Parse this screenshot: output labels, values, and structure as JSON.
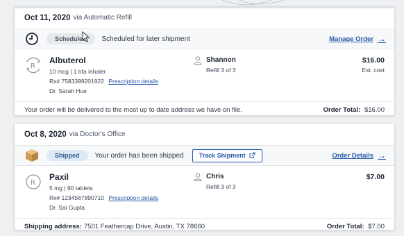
{
  "orders": [
    {
      "date": "Oct 11, 2020",
      "via": "via Automatic Refill",
      "badge": "Scheduled",
      "status_text": "Scheduled for later shipment",
      "action_label": "Manage Order",
      "status_icon": "clock-icon",
      "medication": {
        "name": "Albuterol",
        "dosage": "10 mcg | 1 hfa inhaler",
        "rx_number": "Rx# 7583399201922",
        "rx_link": "Prescription details",
        "doctor": "Dr. Sarah Hue",
        "patient": "Shannon",
        "refill": "Refill 3 of 3",
        "price": "$16.00",
        "price_note": "Est. cost"
      },
      "footer_text": "Your order will be delivered to the most up to date address we have on file.",
      "order_total_label": "Order Total:",
      "order_total_value": "$16.00"
    },
    {
      "date": "Oct 8, 2020",
      "via": "via Doctor's Office",
      "badge": "Shipped",
      "status_text": "Your order has been shipped",
      "track_label": "Track Shipment",
      "action_label": "Order Details",
      "status_icon": "package-icon",
      "medication": {
        "name": "Paxil",
        "dosage": "5 mg | 90 tablets",
        "rx_number": "Rx# 1234567890710",
        "rx_link": "Prescription details",
        "doctor": "Dr. Sai Gupta",
        "patient": "Chris",
        "refill": "Refill 3 of 3",
        "price": "$7.00"
      },
      "shipping_label": "Shipping address:",
      "shipping_address": "7501 Feathercap Drive, Austin, TX 78660",
      "order_total_label": "Order Total:",
      "order_total_value": "$7.00"
    }
  ],
  "colors": {
    "link": "#2356a8",
    "scheduled_badge": "#e6e8eb",
    "shipped_badge": "#dde9f6",
    "package": "#d9a55f"
  }
}
